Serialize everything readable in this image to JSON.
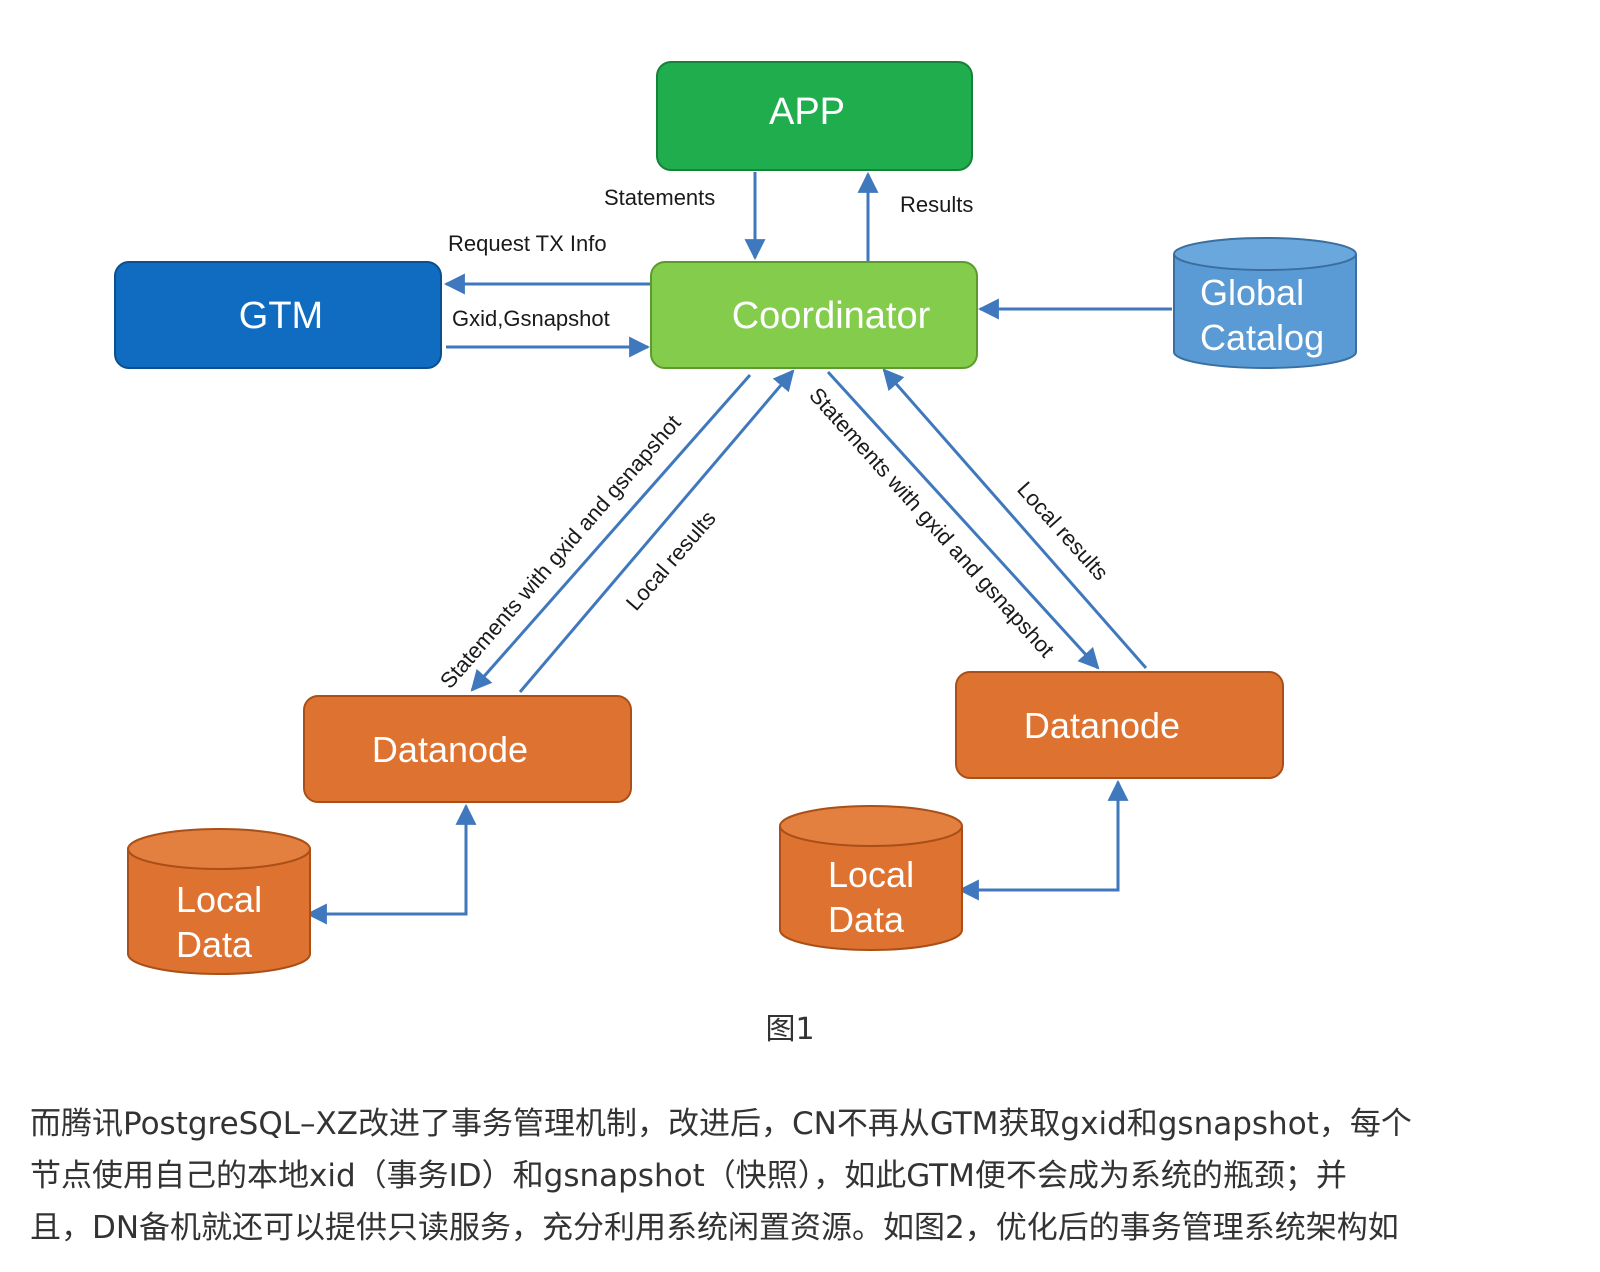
{
  "diagram": {
    "nodes": {
      "app": "APP",
      "gtm": "GTM",
      "coordinator": "Coordinator",
      "global_catalog": [
        "Global",
        "Catalog"
      ],
      "datanode_left": "Datanode",
      "datanode_right": "Datanode",
      "local_data_left": [
        "Local",
        "Data"
      ],
      "local_data_right": [
        "Local",
        "Data"
      ]
    },
    "edges": {
      "statements": "Statements",
      "results": "Results",
      "request_tx_info": "Request TX Info",
      "gxid_gsnapshot": "Gxid,Gsnapshot",
      "statements_with_gxid_left": "Statements with gxid and gsnapshot",
      "local_results_left": "Local results",
      "statements_with_gxid_right": "Statements with gxid and gsnapshot",
      "local_results_right": "Local results"
    },
    "colors": {
      "app": "#1fad4e",
      "gtm": "#0f6cc1",
      "coordinator": "#84cc4c",
      "global_catalog": "#5b9bd5",
      "datanode": "#de7331",
      "arrow": "#3f78bd"
    }
  },
  "caption": "图1",
  "paragraph": "而腾讯PostgreSQL–XZ改进了事务管理机制，改进后，CN不再从GTM获取gxid和gsnapshot，每个\n节点使用自己的本地xid（事务ID）和gsnapshot（快照），如此GTM便不会成为系统的瓶颈；并\n且，DN备机就还可以提供只读服务，充分利用系统闲置资源。如图2，优化后的事务管理系统架构如"
}
